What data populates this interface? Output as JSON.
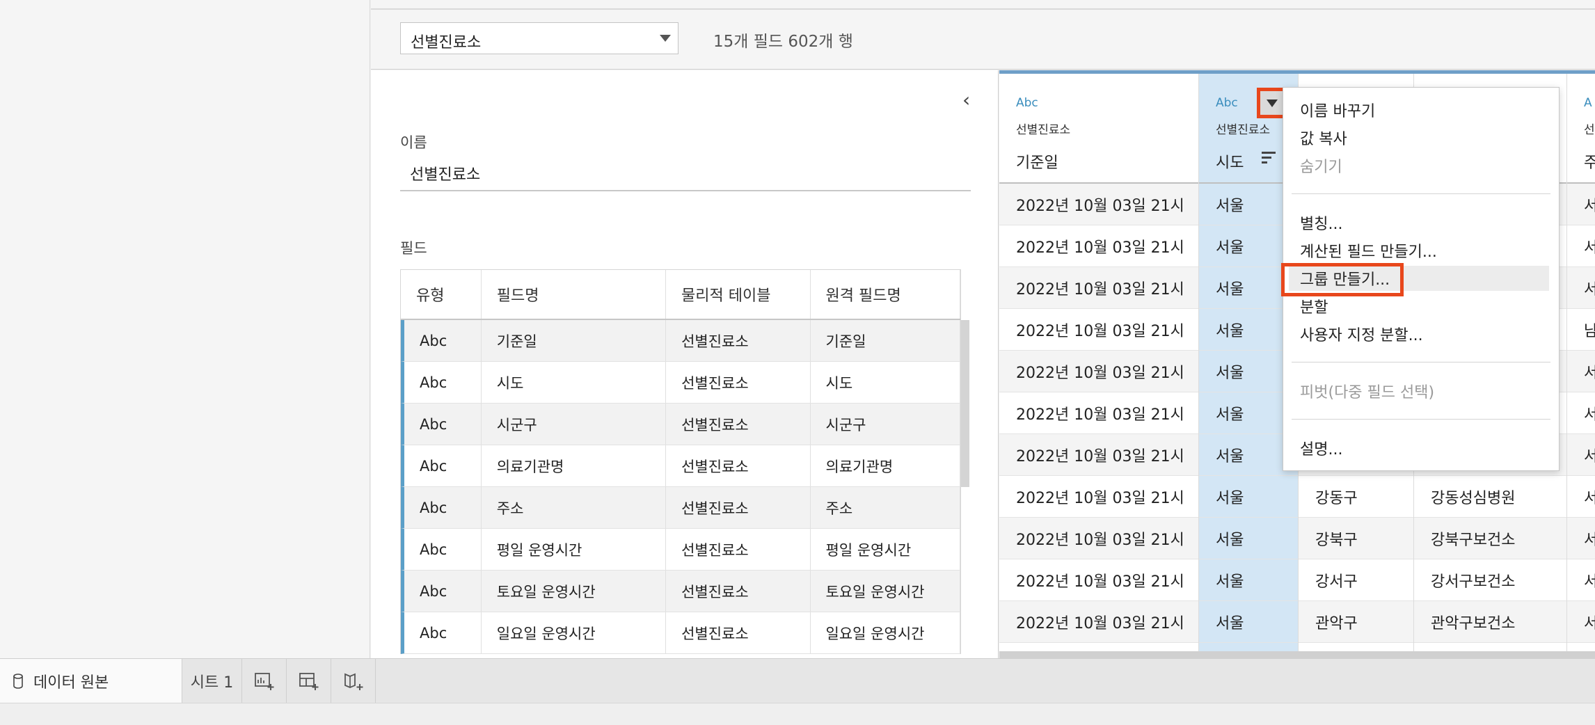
{
  "datasource": {
    "selector_value": "선별진료소",
    "field_count_text": "15개 필드 602개 행"
  },
  "meta": {
    "collapse_glyph": "‹",
    "name_label": "이름",
    "name_value": "선별진료소",
    "fields_label": "필드",
    "table_headers": [
      "유형",
      "필드명",
      "물리적 테이블",
      "원격 필드명"
    ],
    "rows": [
      {
        "type": "Abc",
        "field": "기준일",
        "table": "선별진료소",
        "remote": "기준일"
      },
      {
        "type": "Abc",
        "field": "시도",
        "table": "선별진료소",
        "remote": "시도"
      },
      {
        "type": "Abc",
        "field": "시군구",
        "table": "선별진료소",
        "remote": "시군구"
      },
      {
        "type": "Abc",
        "field": "의료기관명",
        "table": "선별진료소",
        "remote": "의료기관명"
      },
      {
        "type": "Abc",
        "field": "주소",
        "table": "선별진료소",
        "remote": "주소"
      },
      {
        "type": "Abc",
        "field": "평일 운영시간",
        "table": "선별진료소",
        "remote": "평일 운영시간"
      },
      {
        "type": "Abc",
        "field": "토요일 운영시간",
        "table": "선별진료소",
        "remote": "토요일 운영시간"
      },
      {
        "type": "Abc",
        "field": "일요일 운영시간",
        "table": "선별진료소",
        "remote": "일요일 운영시간"
      }
    ]
  },
  "grid": {
    "columns": [
      {
        "type": "Abc",
        "table": "선별진료소",
        "name": "기준일"
      },
      {
        "type": "Abc",
        "table": "선별진료소",
        "name": "시도"
      },
      {
        "type": "",
        "table": "",
        "name": ""
      },
      {
        "type": "",
        "table": "",
        "name": ""
      },
      {
        "type": "A",
        "table": "선",
        "name": "주"
      }
    ],
    "col1": [
      "2022년 10월 03일 21시",
      "2022년 10월 03일 21시",
      "2022년 10월 03일 21시",
      "2022년 10월 03일 21시",
      "2022년 10월 03일 21시",
      "2022년 10월 03일 21시",
      "2022년 10월 03일 21시",
      "2022년 10월 03일 21시",
      "2022년 10월 03일 21시",
      "2022년 10월 03일 21시",
      "2022년 10월 03일 21시"
    ],
    "col2": [
      "서울",
      "서울",
      "서울",
      "서울",
      "서울",
      "서울",
      "서울",
      "서울",
      "서울",
      "서울",
      "서울"
    ],
    "col3": [
      "",
      "",
      "",
      "",
      "",
      "",
      "",
      "강동구",
      "강북구",
      "강서구",
      "관악구"
    ],
    "col4": [
      "",
      "",
      "",
      "",
      "",
      "",
      "",
      "강동성심병원",
      "강북구보건소",
      "강서구보건소",
      "관악구보건소"
    ],
    "col5": [
      "서",
      "서",
      "서",
      "남",
      "서",
      "서",
      "서",
      "서",
      "서",
      "서",
      "서"
    ]
  },
  "context_menu": {
    "items": [
      {
        "label": "이름 바꾸기",
        "enabled": true
      },
      {
        "label": "값 복사",
        "enabled": true
      },
      {
        "label": "숨기기",
        "enabled": false
      },
      {
        "label": "별칭...",
        "enabled": true
      },
      {
        "label": "계산된 필드 만들기...",
        "enabled": true
      },
      {
        "label": "그룹 만들기...",
        "enabled": true,
        "highlighted": true
      },
      {
        "label": "분할",
        "enabled": true
      },
      {
        "label": "사용자 지정 분할...",
        "enabled": true
      },
      {
        "label": "피벗(다중 필드 선택)",
        "enabled": false
      },
      {
        "label": "설명...",
        "enabled": true
      }
    ]
  },
  "bottom_tabs": {
    "datasource_tab": "데이터 원본",
    "sheet_tab": "시트 1",
    "icons": [
      "new-worksheet-icon",
      "new-dashboard-icon",
      "new-story-icon"
    ]
  },
  "colors": {
    "accent_blue": "#3a8dbd",
    "highlight_red": "#e8471c",
    "selected_column": "#d3e6f5"
  }
}
